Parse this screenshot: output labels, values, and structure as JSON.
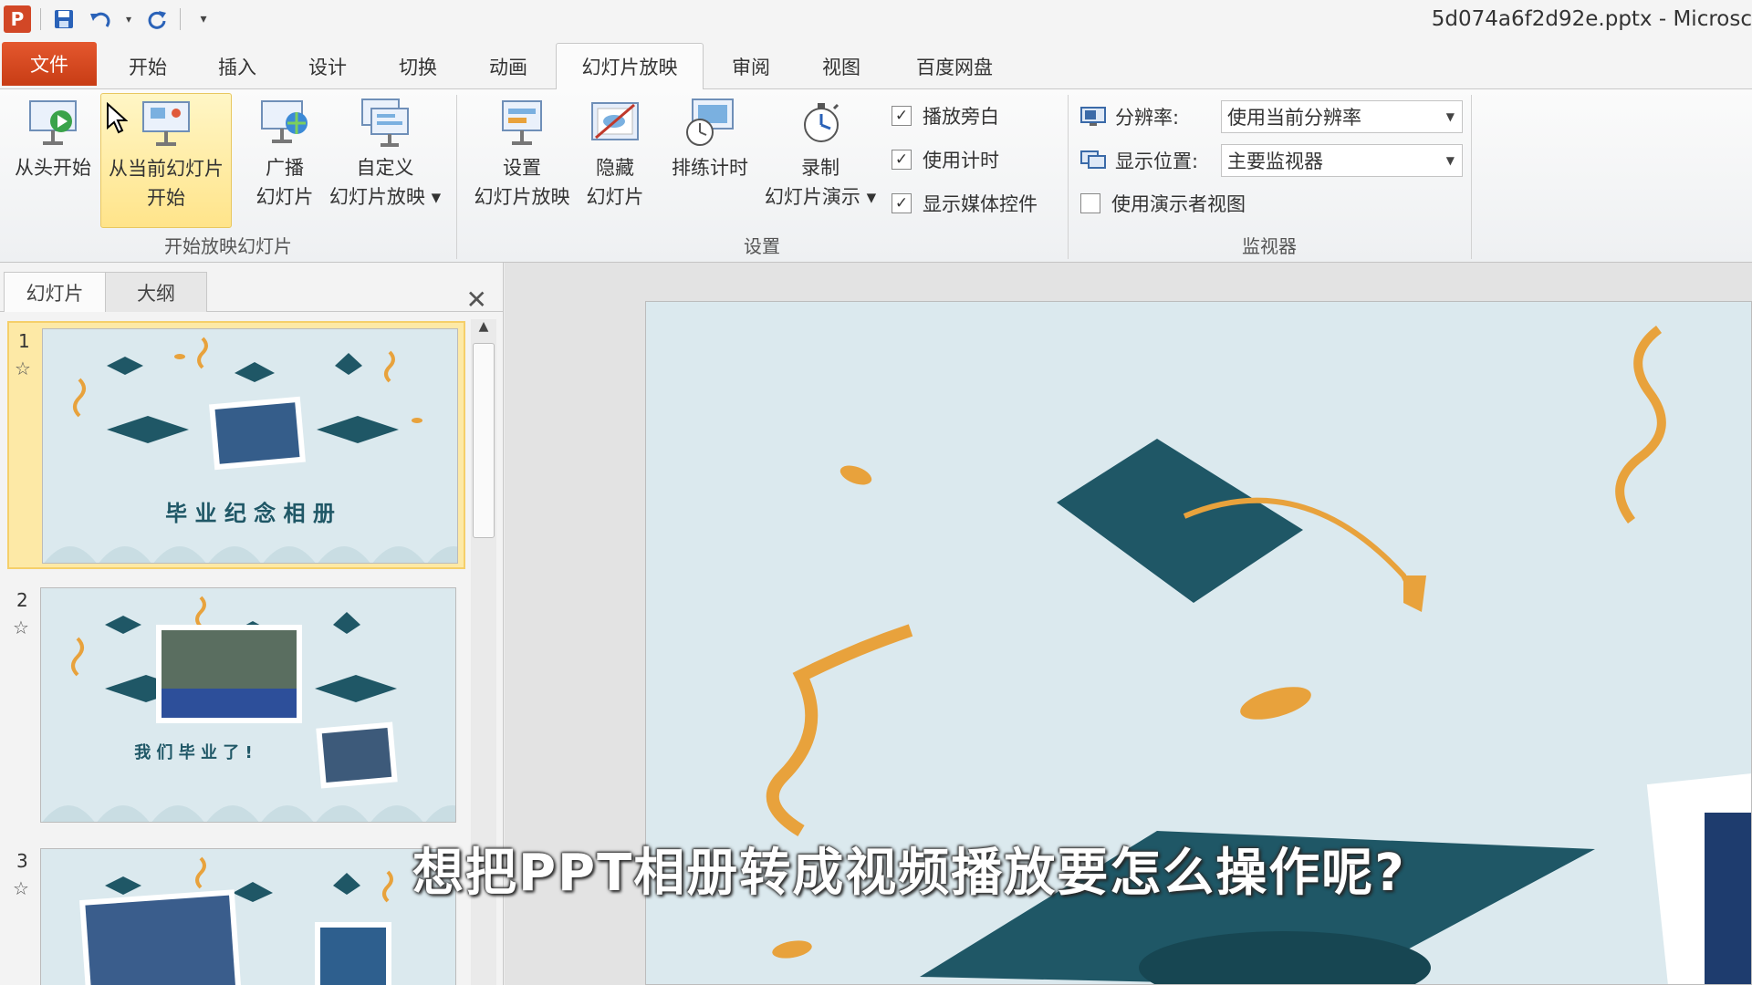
{
  "title_bar": {
    "app_logo": "P",
    "window_title": "5d074a6f2d92e.pptx - Microsc"
  },
  "ribbon_tabs": [
    {
      "label": "文件"
    },
    {
      "label": "开始"
    },
    {
      "label": "插入"
    },
    {
      "label": "设计"
    },
    {
      "label": "切换"
    },
    {
      "label": "动画"
    },
    {
      "label": "幻灯片放映"
    },
    {
      "label": "审阅"
    },
    {
      "label": "视图"
    },
    {
      "label": "百度网盘"
    }
  ],
  "ribbon": {
    "start_group": {
      "label": "开始放映幻灯片",
      "from_beginning": "从头开始",
      "from_current_line1": "从当前幻灯片",
      "from_current_line2": "开始",
      "broadcast_line1": "广播",
      "broadcast_line2": "幻灯片",
      "custom_line1": "自定义",
      "custom_line2": "幻灯片放映 ▾"
    },
    "setup_group": {
      "label": "设置",
      "setup_line1": "设置",
      "setup_line2": "幻灯片放映",
      "hide_line1": "隐藏",
      "hide_line2": "幻灯片",
      "rehearse": "排练计时",
      "record_line1": "录制",
      "record_line2": "幻灯片演示 ▾",
      "checks": [
        {
          "label": "播放旁白",
          "checked": true
        },
        {
          "label": "使用计时",
          "checked": true
        },
        {
          "label": "显示媒体控件",
          "checked": true
        }
      ]
    },
    "monitor_group": {
      "label": "监视器",
      "resolution_label": "分辨率:",
      "resolution_value": "使用当前分辨率",
      "show_on_label": "显示位置:",
      "show_on_value": "主要监视器",
      "presenter_view": "使用演示者视图",
      "presenter_view_checked": false
    }
  },
  "slides_panel": {
    "tab_slides": "幻灯片",
    "tab_outline": "大纲",
    "close": "✕",
    "slides": [
      {
        "number": "1",
        "title": "毕 业 纪 念 相 册"
      },
      {
        "number": "2",
        "title": "我 们 毕 业 了 !"
      },
      {
        "number": "3",
        "title": ""
      }
    ]
  },
  "caption": "想把PPT相册转成视频播放要怎么操作呢?",
  "colors": {
    "accent_orange": "#e4572e",
    "cap_teal": "#1f5766",
    "confetti": "#e8a23c",
    "slide_bg": "#dbe9ee"
  }
}
